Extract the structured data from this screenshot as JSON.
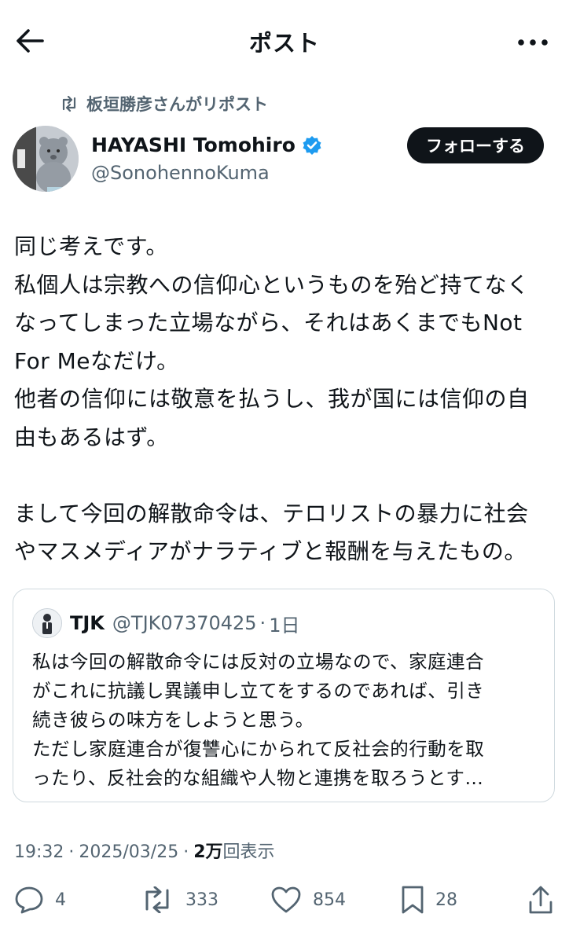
{
  "header": {
    "title": "ポスト",
    "back_icon": "arrow-left-icon",
    "more_icon": "more-horizontal-icon"
  },
  "repost": {
    "text": "板垣勝彦さんがリポスト",
    "icon": "repost-icon"
  },
  "author": {
    "name": "HAYASHI Tomohiro",
    "handle": "@SonohennoKuma",
    "verified": true,
    "follow_label": "フォローする"
  },
  "tweet": {
    "text": "同じ考えです。\n私個人は宗教への信仰心というものを殆ど持てなく\nなってしまった立場ながら、それはあくまでもNot\nFor Meなだけ。\n他者の信仰には敬意を払うし、我が国には信仰の自\n由もあるはず。\n\nまして今回の解散命令は、テロリストの暴力に社会\nやマスメディアがナラティブと報酬を与えたもの。"
  },
  "quote": {
    "name": "TJK",
    "handle": "@TJK07370425",
    "separator": "·",
    "time": "1日",
    "text": "私は今回の解散命令には反対の立場なので、家庭連合\nがこれに抗議し異議申し立てをするのであれば、引き\n続き彼らの味方をしようと思う。\nただし家庭連合が復讐心にかられて反社会的行動を取\nったり、反社会的な組織や人物と連携を取ろうとす…"
  },
  "meta": {
    "time": "19:32",
    "dot1": "·",
    "date": "2025/03/25",
    "dot2": "·",
    "views_count": "2万",
    "views_label": "回表示"
  },
  "actions": {
    "replies": "4",
    "reposts": "333",
    "likes": "854",
    "bookmarks": "28"
  },
  "colors": {
    "text": "#0f1419",
    "secondary": "#536471",
    "verified": "#1d9bf0",
    "border": "#cfd9de"
  }
}
